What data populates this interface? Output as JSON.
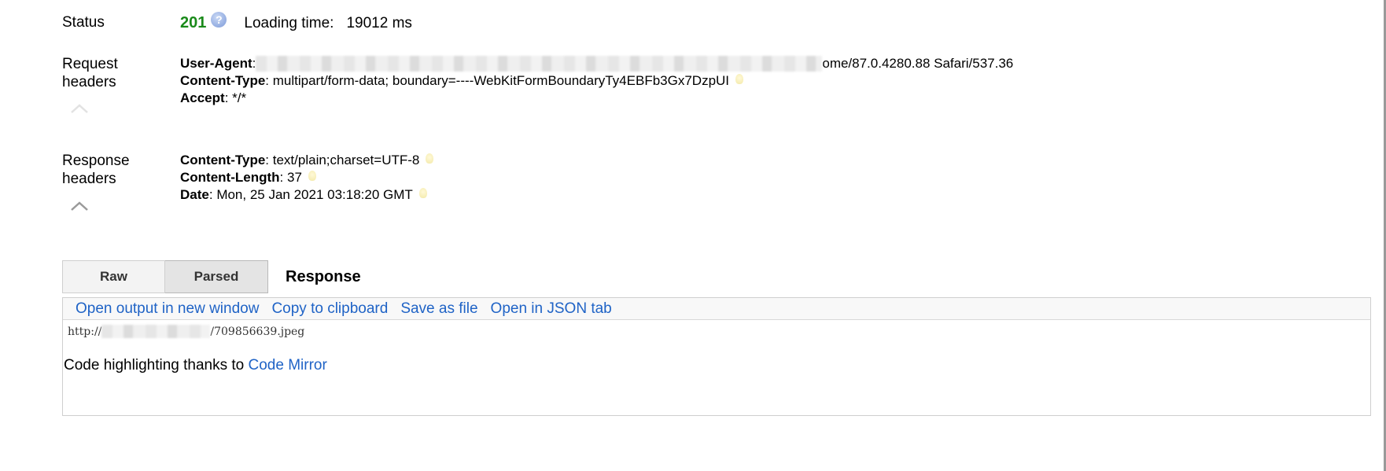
{
  "status": {
    "label": "Status",
    "code": "201",
    "help_glyph": "?",
    "loading_label": "Loading time:",
    "loading_value": "19012 ms"
  },
  "request_headers": {
    "label_line1": "Request",
    "label_line2": "headers",
    "items": [
      {
        "name": "User-Agent",
        "sep": ":",
        "value": "ome/87.0.4280.88 Safari/537.36"
      },
      {
        "name": "Content-Type",
        "sep": ":",
        "value": " multipart/form-data; boundary=----WebKitFormBoundaryTy4EBFb3Gx7DzpUI"
      },
      {
        "name": "Accept",
        "sep": ":",
        "value": " */*"
      }
    ]
  },
  "response_headers": {
    "label_line1": "Response",
    "label_line2": "headers",
    "items": [
      {
        "name": "Content-Type",
        "sep": ":",
        "value": " text/plain;charset=UTF-8"
      },
      {
        "name": "Content-Length",
        "sep": ":",
        "value": " 37"
      },
      {
        "name": "Date",
        "sep": ":",
        "value": " Mon, 25 Jan 2021 03:18:20 GMT"
      }
    ]
  },
  "tabs": {
    "raw": "Raw",
    "parsed": "Parsed",
    "title": "Response"
  },
  "toolbar": {
    "open_window": "Open output in new window",
    "copy": "Copy to clipboard",
    "save": "Save as file",
    "open_json": "Open in JSON tab"
  },
  "output": {
    "prefix": "http://",
    "suffix": "/709856639.jpeg"
  },
  "credit": {
    "text": "Code highlighting thanks to ",
    "link": "Code Mirror"
  },
  "colors": {
    "status_ok": "#1a8a1a",
    "link": "#1f63c6"
  }
}
